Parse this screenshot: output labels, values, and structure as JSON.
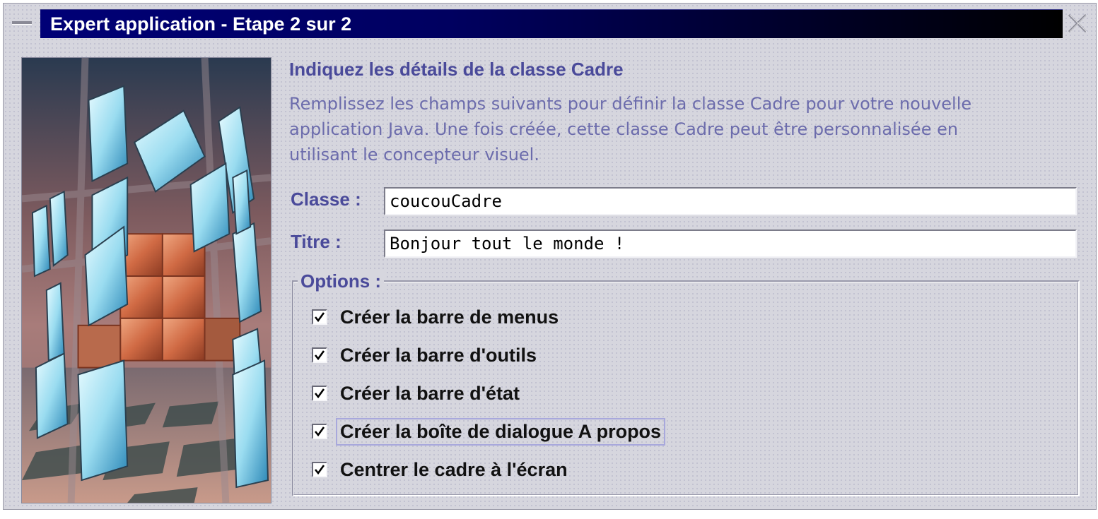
{
  "window": {
    "title": "Expert application - Etape 2 sur 2"
  },
  "content": {
    "heading": "Indiquez les détails de la classe Cadre",
    "description_lines": [
      "Remplissez les champs suivants pour définir la classe Cadre pour votre nouvelle",
      "application Java. Une fois créée, cette classe Cadre peut être personnalisée en",
      "utilisant le concepteur visuel."
    ]
  },
  "fields": {
    "classe": {
      "label": "Classe :",
      "value": "coucouCadre"
    },
    "titre": {
      "label": "Titre :",
      "value": "Bonjour tout le monde !"
    }
  },
  "options": {
    "legend": "Options :",
    "items": [
      {
        "label": "Créer la barre de menus",
        "checked": true
      },
      {
        "label": "Créer la barre d'outils",
        "checked": true
      },
      {
        "label": "Créer la barre d'état",
        "checked": true
      },
      {
        "label": "Créer la boîte de dialogue A propos",
        "checked": true,
        "focused": true
      },
      {
        "label": "Centrer le cadre à l'écran",
        "checked": true
      }
    ]
  },
  "colors": {
    "titlebar_start": "#000076",
    "titlebar_end": "#000000",
    "accent_text": "#4a4a9a",
    "description_text": "#6c6cac",
    "window_bg": "#d6d6de"
  }
}
